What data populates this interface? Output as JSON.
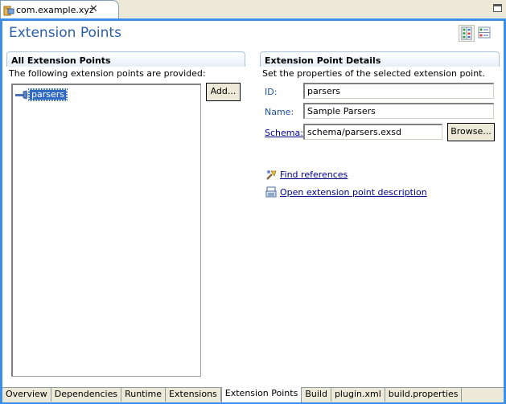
{
  "editor": {
    "tab_title": "com.example.xyz",
    "tab_icon": "plugin-manifest-icon",
    "close_icon": "close-icon",
    "maximize_icon": "maximize-icon"
  },
  "page": {
    "title": "Extension Points",
    "toolbar": [
      {
        "name": "horizontal-layout-icon",
        "active": true
      },
      {
        "name": "vertical-layout-icon",
        "active": false
      }
    ]
  },
  "left_section": {
    "title": "All Extension Points",
    "description": "The following extension points are provided:",
    "items": [
      {
        "label": "parsers",
        "icon": "extension-point-icon",
        "selected": true
      }
    ],
    "add_button": "Add..."
  },
  "right_section": {
    "title": "Extension Point Details",
    "description": "Set the properties of the selected extension point.",
    "fields": {
      "id_label": "ID:",
      "id_value": "parsers",
      "name_label": "Name:",
      "name_value": "Sample Parsers",
      "schema_label": "Schema:",
      "schema_value": "schema/parsers.exsd"
    },
    "browse_button": "Browse...",
    "links": [
      {
        "label": "Find references",
        "icon": "search-references-icon"
      },
      {
        "label": "Open extension point description",
        "icon": "document-icon"
      }
    ]
  },
  "bottom_tabs": [
    {
      "label": "Overview",
      "active": false
    },
    {
      "label": "Dependencies",
      "active": false
    },
    {
      "label": "Runtime",
      "active": false
    },
    {
      "label": "Extensions",
      "active": false
    },
    {
      "label": "Extension Points",
      "active": true
    },
    {
      "label": "Build",
      "active": false
    },
    {
      "label": "plugin.xml",
      "active": false
    },
    {
      "label": "build.properties",
      "active": false
    }
  ]
}
